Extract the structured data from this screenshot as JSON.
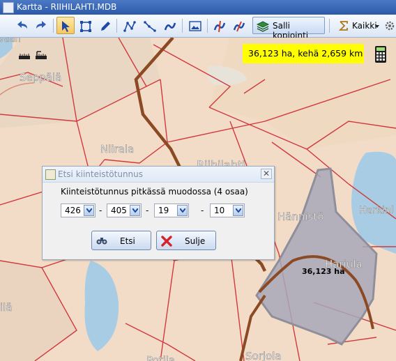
{
  "window": {
    "title": "Kartta - RIIHILAHTI.MDB"
  },
  "toolbar": {
    "copy_label": "Salli kopiointi",
    "all_label": "Kaikki",
    "buttons": [
      {
        "name": "undo",
        "icon": "undo-arrow-icon"
      },
      {
        "name": "redo",
        "icon": "redo-arrow-icon"
      },
      {
        "name": "select",
        "icon": "pointer-arrow-icon",
        "active": true
      },
      {
        "name": "area",
        "icon": "square-select-icon"
      },
      {
        "name": "draw",
        "icon": "pencil-icon"
      },
      {
        "name": "polyline",
        "icon": "polyline-icon"
      },
      {
        "name": "line",
        "icon": "line-icon"
      },
      {
        "name": "smooth",
        "icon": "curve-icon"
      },
      {
        "name": "image",
        "icon": "picture-icon"
      },
      {
        "name": "split",
        "icon": "split-map-icon"
      },
      {
        "name": "merge",
        "icon": "merge-map-icon"
      }
    ],
    "accent": "#2c5aa8"
  },
  "map": {
    "labels": {
      "seppala": "Seppälä",
      "niirala": "Niirala",
      "riihilahti": "Riihilahti",
      "hannisto": "Hännistö",
      "harkinlahti": "Harkinl",
      "hariula": "Hariula",
      "ila": "ilä",
      "sorjola": "Sorjola",
      "potila": "Potila",
      "vaara": "vaan"
    },
    "area_label": "36,123 ha",
    "measure": "36,123 ha, kehä 2,659 km",
    "colors": {
      "land": "#f3dcc7",
      "boundary": "#d0393e",
      "road": "#8b4a23",
      "water": "#a9cce5",
      "selection": "#a7a8b8",
      "measure_bg": "#ffff00"
    }
  },
  "dialog": {
    "title": "Etsi kiinteistötunnus",
    "prompt": "Kiinteistötunnus pitkässä muodossa (4 osaa)",
    "parts": [
      "426",
      "405",
      "19",
      "10"
    ],
    "separator": "-",
    "search_label": "Etsi",
    "close_label": "Sulje",
    "close_glyph": "✕"
  }
}
